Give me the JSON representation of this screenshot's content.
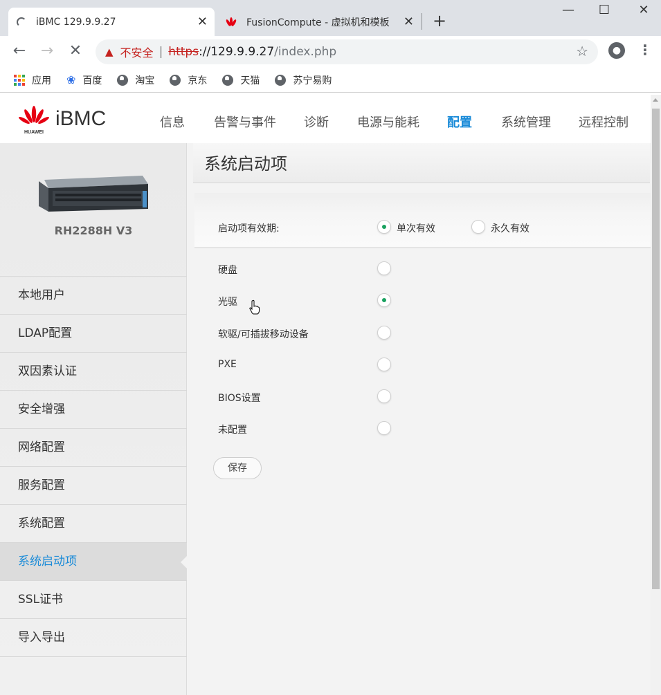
{
  "browser": {
    "tabs": [
      {
        "title": "iBMC 129.9.9.27",
        "active": true
      },
      {
        "title": "FusionCompute - 虚拟机和模板",
        "active": false
      }
    ],
    "window_controls": {
      "minimize": "—",
      "maximize": "☐",
      "close": "✕"
    },
    "address": {
      "security_label": "不安全",
      "scheme": "https",
      "host": "://129.9.9.27",
      "path": "/index.php"
    },
    "bookmarks": [
      "应用",
      "百度",
      "淘宝",
      "京东",
      "天猫",
      "苏宁易购"
    ]
  },
  "header": {
    "brand": "iBMC",
    "logo_text": "HUAWEI",
    "nav": [
      {
        "label": "信息",
        "active": false
      },
      {
        "label": "告警与事件",
        "active": false
      },
      {
        "label": "诊断",
        "active": false
      },
      {
        "label": "电源与能耗",
        "active": false
      },
      {
        "label": "配置",
        "active": true
      },
      {
        "label": "系统管理",
        "active": false
      },
      {
        "label": "远程控制",
        "active": false
      }
    ]
  },
  "sidebar": {
    "model": "RH2288H V3",
    "items": [
      {
        "label": "本地用户",
        "active": false
      },
      {
        "label": "LDAP配置",
        "active": false
      },
      {
        "label": "双因素认证",
        "active": false
      },
      {
        "label": "安全增强",
        "active": false
      },
      {
        "label": "网络配置",
        "active": false
      },
      {
        "label": "服务配置",
        "active": false
      },
      {
        "label": "系统配置",
        "active": false
      },
      {
        "label": "系统启动项",
        "active": true
      },
      {
        "label": "SSL证书",
        "active": false
      },
      {
        "label": "导入导出",
        "active": false
      }
    ]
  },
  "main": {
    "title": "系统启动项",
    "validity": {
      "label": "启动项有效期:",
      "options": [
        {
          "label": "单次有效",
          "selected": true
        },
        {
          "label": "永久有效",
          "selected": false
        }
      ]
    },
    "boot_devices": [
      {
        "label": "硬盘",
        "selected": false
      },
      {
        "label": "光驱",
        "selected": true
      },
      {
        "label": "软驱/可插拔移动设备",
        "selected": false
      },
      {
        "label": "PXE",
        "selected": false
      },
      {
        "label": "BIOS设置",
        "selected": false
      },
      {
        "label": "未配置",
        "selected": false
      }
    ],
    "save_label": "保存"
  },
  "colors": {
    "accent": "#1a8bd8",
    "radio_selected": "#19a15f",
    "huawei_red": "#e60012",
    "insecure_red": "#c5221f"
  }
}
